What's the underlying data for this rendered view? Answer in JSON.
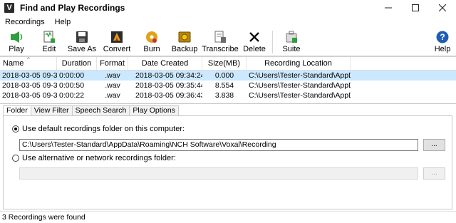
{
  "window": {
    "title": "Find and Play Recordings",
    "icon_letter": "V",
    "controls": [
      "minimize-icon",
      "maximize-icon",
      "close-icon"
    ]
  },
  "menubar": [
    {
      "label": "Recordings"
    },
    {
      "label": "Help"
    }
  ],
  "toolbar": [
    {
      "label": "Play",
      "icon": "play-icon",
      "color": "#2e9e3e"
    },
    {
      "label": "Edit",
      "icon": "edit-icon",
      "color": "#2e9e3e"
    },
    {
      "label": "Save As",
      "icon": "save-icon",
      "color": "#3a3a3a"
    },
    {
      "label": "Convert",
      "icon": "convert-icon",
      "color": "#e0a21b"
    },
    {
      "label": "Burn",
      "icon": "burn-disc-icon",
      "color": "#e0a21b"
    },
    {
      "label": "Backup",
      "icon": "backup-safe-icon",
      "color": "#b8860b"
    },
    {
      "label": "Transcribe",
      "icon": "transcribe-icon",
      "color": "#6b6b6b"
    },
    {
      "label": "Delete",
      "icon": "delete-icon",
      "color": "#111111"
    },
    {
      "label": "Suite",
      "icon": "suite-icon",
      "color": "#2e9e3e"
    },
    {
      "label": "Help",
      "icon": "help-icon",
      "color": "#1e5fb4"
    }
  ],
  "list": {
    "columns": [
      "Name",
      "Duration",
      "Format",
      "Date Created",
      "Size(MB)",
      "Recording Location"
    ],
    "rows": [
      {
        "name": "2018-03-05 09-3...",
        "duration": "0:00:00",
        "format": ".wav",
        "date": "2018-03-05 09:34:24",
        "size": "0.000",
        "location": "C:\\Users\\Tester-Standard\\AppDat...",
        "selected": true
      },
      {
        "name": "2018-03-05 09-3...",
        "duration": "0:00:50",
        "format": ".wav",
        "date": "2018-03-05 09:35:44",
        "size": "8.554",
        "location": "C:\\Users\\Tester-Standard\\AppDat...",
        "selected": false
      },
      {
        "name": "2018-03-05 09-3...",
        "duration": "0:00:22",
        "format": ".wav",
        "date": "2018-03-05 09:36:43",
        "size": "3.838",
        "location": "C:\\Users\\Tester-Standard\\AppDat...",
        "selected": false
      }
    ]
  },
  "tabs": [
    {
      "label": "Folder",
      "active": true
    },
    {
      "label": "View Filter",
      "active": false
    },
    {
      "label": "Speech Search",
      "active": false
    },
    {
      "label": "Play Options",
      "active": false
    }
  ],
  "folder_panel": {
    "default_option_label": "Use default recordings folder on this computer:",
    "default_path": "C:\\Users\\Tester-Standard\\AppData\\Roaming\\NCH Software\\Voxal\\Recording",
    "browse_label": "...",
    "alt_option_label": "Use alternative or network recordings folder:",
    "alt_path": "",
    "alt_browse_label": "..."
  },
  "status": "3 Recordings were found",
  "colors": {
    "selected_row": "#cce8ff",
    "window_bg": "#ffffff"
  }
}
